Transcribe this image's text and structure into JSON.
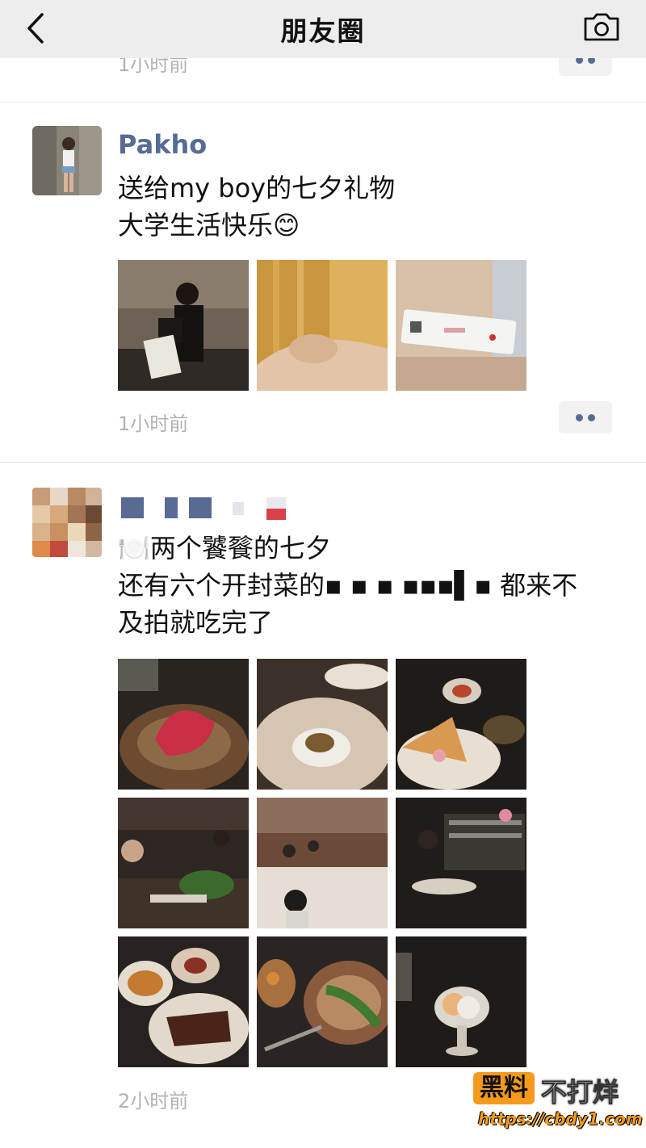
{
  "nav": {
    "title": "朋友圈",
    "back_icon": "chevron-left-icon",
    "camera_icon": "camera-icon"
  },
  "prev_post": {
    "time": "1小时前"
  },
  "posts": [
    {
      "name": "Pakho",
      "text": "送给my boy的七夕礼物\n大学生活快乐😊",
      "time": "1小时前",
      "image_count": 3
    },
    {
      "name": "",
      "text": "🍽️两个饕餮的七夕\n还有六个开封菜的▪ ▪ ▪  ▪▪▪▌▪ 都来不\n及拍就吃完了",
      "time": "2小时前",
      "image_count": 9
    }
  ],
  "watermark": {
    "badge": "黑料",
    "text": "不打烊",
    "url": "https://cbdy1.com"
  },
  "colors": {
    "link": "#576b95",
    "time": "#b2b2b2",
    "navbar": "#ededed",
    "watermark": "#f59a1d"
  }
}
